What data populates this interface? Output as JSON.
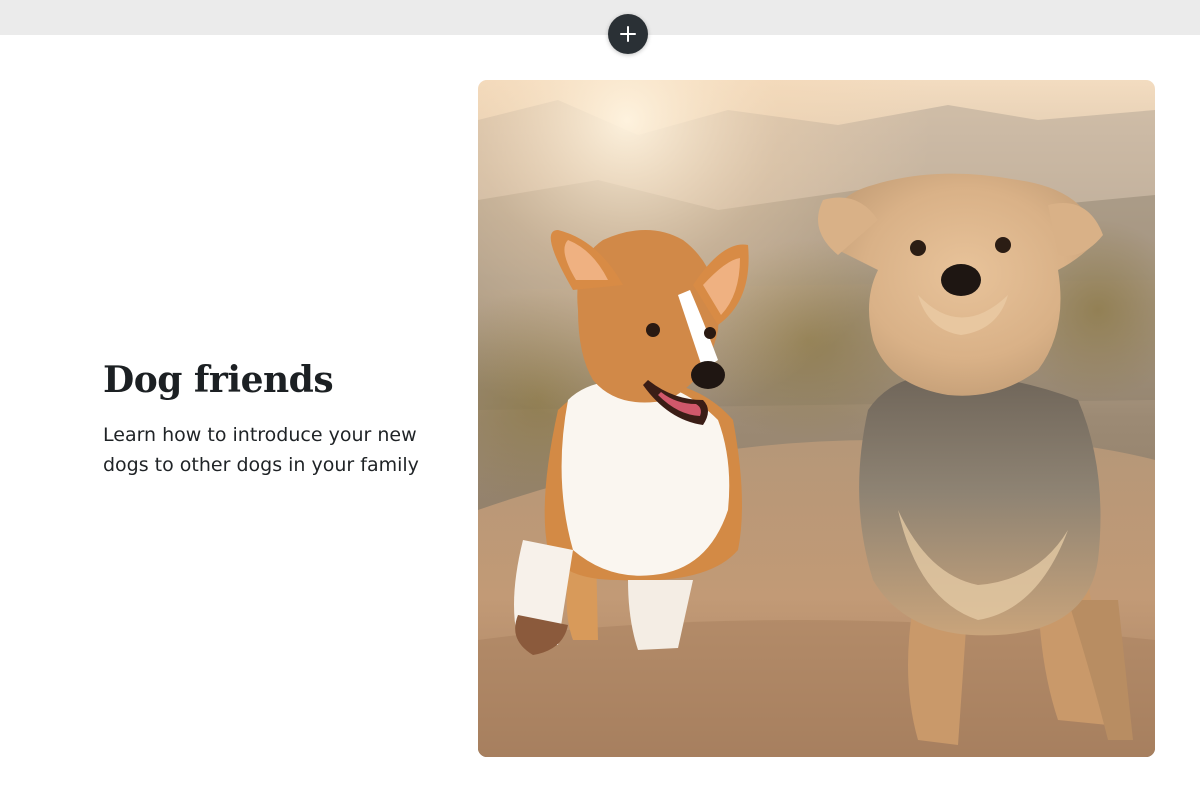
{
  "toolbar": {
    "add_button_icon": "plus-icon"
  },
  "section": {
    "title": "Dog friends",
    "subtitle": "Learn how to introduce your new dogs to other dogs in your family",
    "image_description_icon": "photo-two-dogs-running"
  },
  "colors": {
    "top_band": "#ebebeb",
    "add_button_bg": "#2a3035",
    "heading_text": "#1c2023",
    "body_text": "#1f2326"
  }
}
